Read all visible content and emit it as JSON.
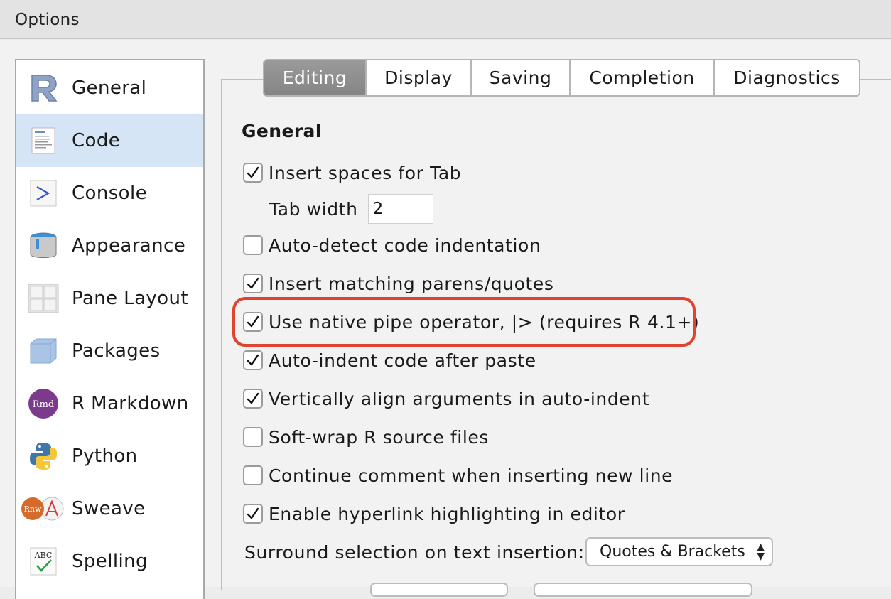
{
  "window": {
    "title": "Options"
  },
  "sidebar": {
    "items": [
      {
        "label": "General",
        "icon": "r-logo-icon"
      },
      {
        "label": "Code",
        "icon": "code-document-icon",
        "selected": true
      },
      {
        "label": "Console",
        "icon": "console-prompt-icon"
      },
      {
        "label": "Appearance",
        "icon": "paint-bucket-icon"
      },
      {
        "label": "Pane Layout",
        "icon": "pane-layout-icon"
      },
      {
        "label": "Packages",
        "icon": "package-box-icon"
      },
      {
        "label": "R Markdown",
        "icon": "rmd-icon"
      },
      {
        "label": "Python",
        "icon": "python-icon"
      },
      {
        "label": "Sweave",
        "icon": "sweave-icon"
      },
      {
        "label": "Spelling",
        "icon": "spelling-icon"
      }
    ]
  },
  "tabs": [
    {
      "label": "Editing",
      "active": true
    },
    {
      "label": "Display"
    },
    {
      "label": "Saving"
    },
    {
      "label": "Completion"
    },
    {
      "label": "Diagnostics"
    }
  ],
  "section": {
    "title": "General"
  },
  "options": [
    {
      "label": "Insert spaces for Tab",
      "checked": true
    },
    {
      "label": "Auto-detect code indentation",
      "checked": false
    },
    {
      "label": "Insert matching parens/quotes",
      "checked": true
    },
    {
      "label": "Use native pipe operator, |> (requires R 4.1+)",
      "checked": true
    },
    {
      "label": "Auto-indent code after paste",
      "checked": true
    },
    {
      "label": "Vertically align arguments in auto-indent",
      "checked": true
    },
    {
      "label": "Soft-wrap R source files",
      "checked": false
    },
    {
      "label": "Continue comment when inserting new line",
      "checked": false
    },
    {
      "label": "Enable hyperlink highlighting in editor",
      "checked": true
    }
  ],
  "tab_width": {
    "label": "Tab width",
    "value": "2"
  },
  "surround": {
    "label": "Surround selection on text insertion:",
    "value": "Quotes & Brackets"
  },
  "colors": {
    "highlight": "#e0442e",
    "selected_bg": "#d5e5f5",
    "active_tab": "#8e8e8e"
  }
}
